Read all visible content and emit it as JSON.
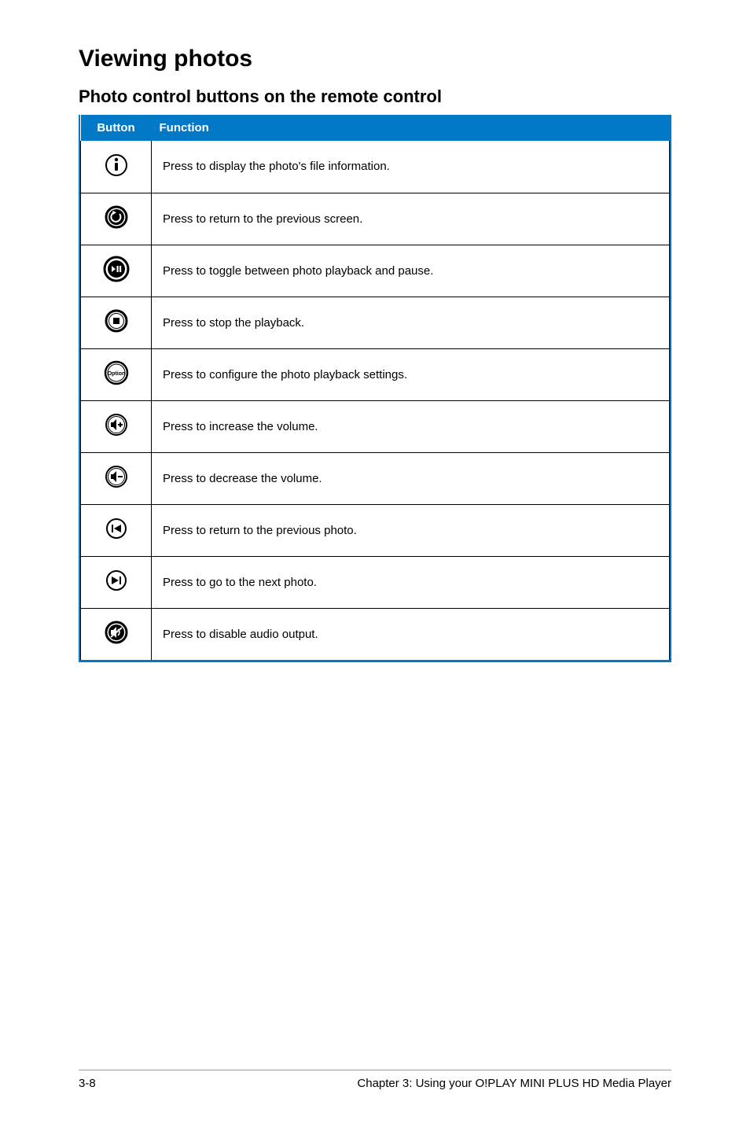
{
  "heading": "Viewing photos",
  "subheading": "Photo control buttons on the remote control",
  "table": {
    "headers": {
      "button": "Button",
      "function": "Function"
    },
    "rows": [
      {
        "icon": "info-icon",
        "function": "Press to display the photo's file information."
      },
      {
        "icon": "return-icon",
        "function": "Press to return to the previous screen."
      },
      {
        "icon": "play-pause-icon",
        "function": "Press to toggle between photo playback and pause."
      },
      {
        "icon": "stop-icon",
        "function": "Press to stop the playback."
      },
      {
        "icon": "option-icon",
        "function": "Press to configure the photo playback settings."
      },
      {
        "icon": "volume-up-icon",
        "function": "Press to increase the volume."
      },
      {
        "icon": "volume-down-icon",
        "function": "Press to decrease the volume."
      },
      {
        "icon": "previous-icon",
        "function": "Press to return to the previous photo."
      },
      {
        "icon": "next-icon",
        "function": "Press to go to the next photo."
      },
      {
        "icon": "mute-icon",
        "function": "Press to disable audio output."
      }
    ]
  },
  "footer": {
    "page": "3-8",
    "chapter": "Chapter 3: Using your O!PLAY MINI PLUS HD Media Player"
  }
}
